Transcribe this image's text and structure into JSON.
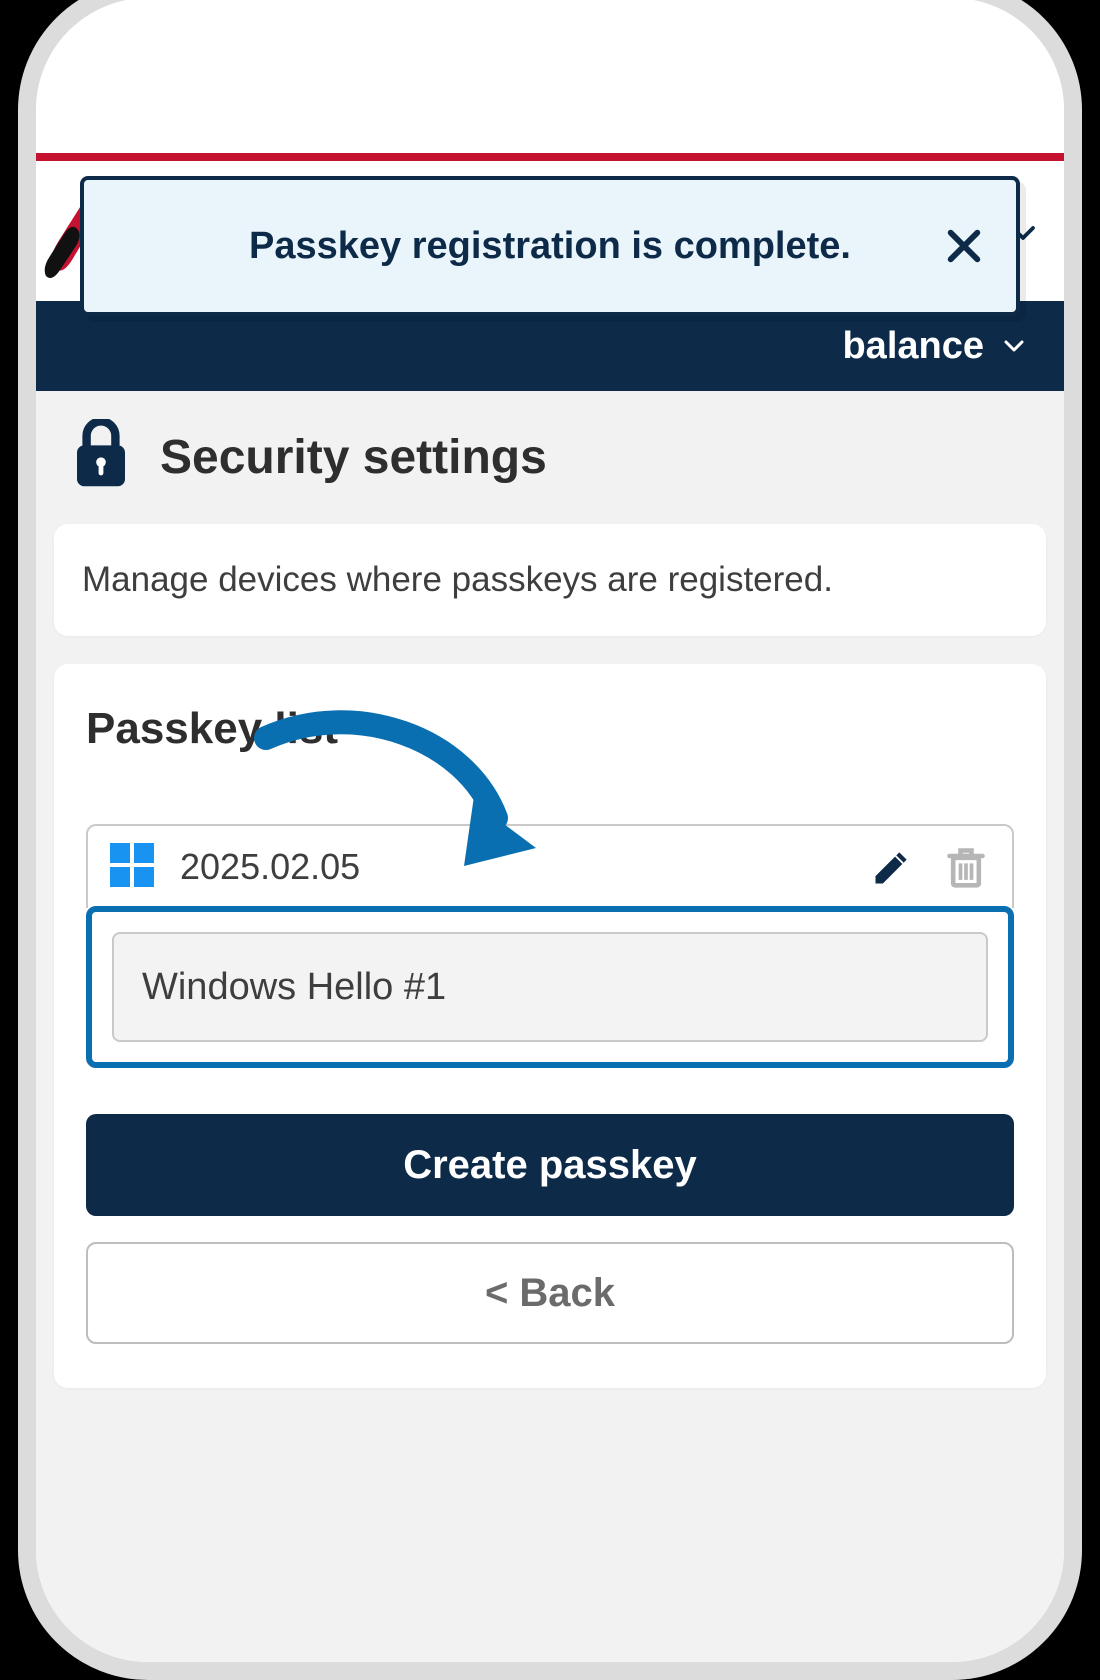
{
  "toast": {
    "message": "Passkey registration is complete."
  },
  "nav": {
    "balance_label": "balance"
  },
  "page": {
    "title": "Security settings",
    "description": "Manage devices where passkeys are registered."
  },
  "passkeys": {
    "list_title": "Passkey list",
    "items": [
      {
        "platform": "windows",
        "date": "2025.02.05",
        "name": "Windows Hello #1"
      }
    ]
  },
  "buttons": {
    "create": "Create passkey",
    "back": "< Back"
  }
}
